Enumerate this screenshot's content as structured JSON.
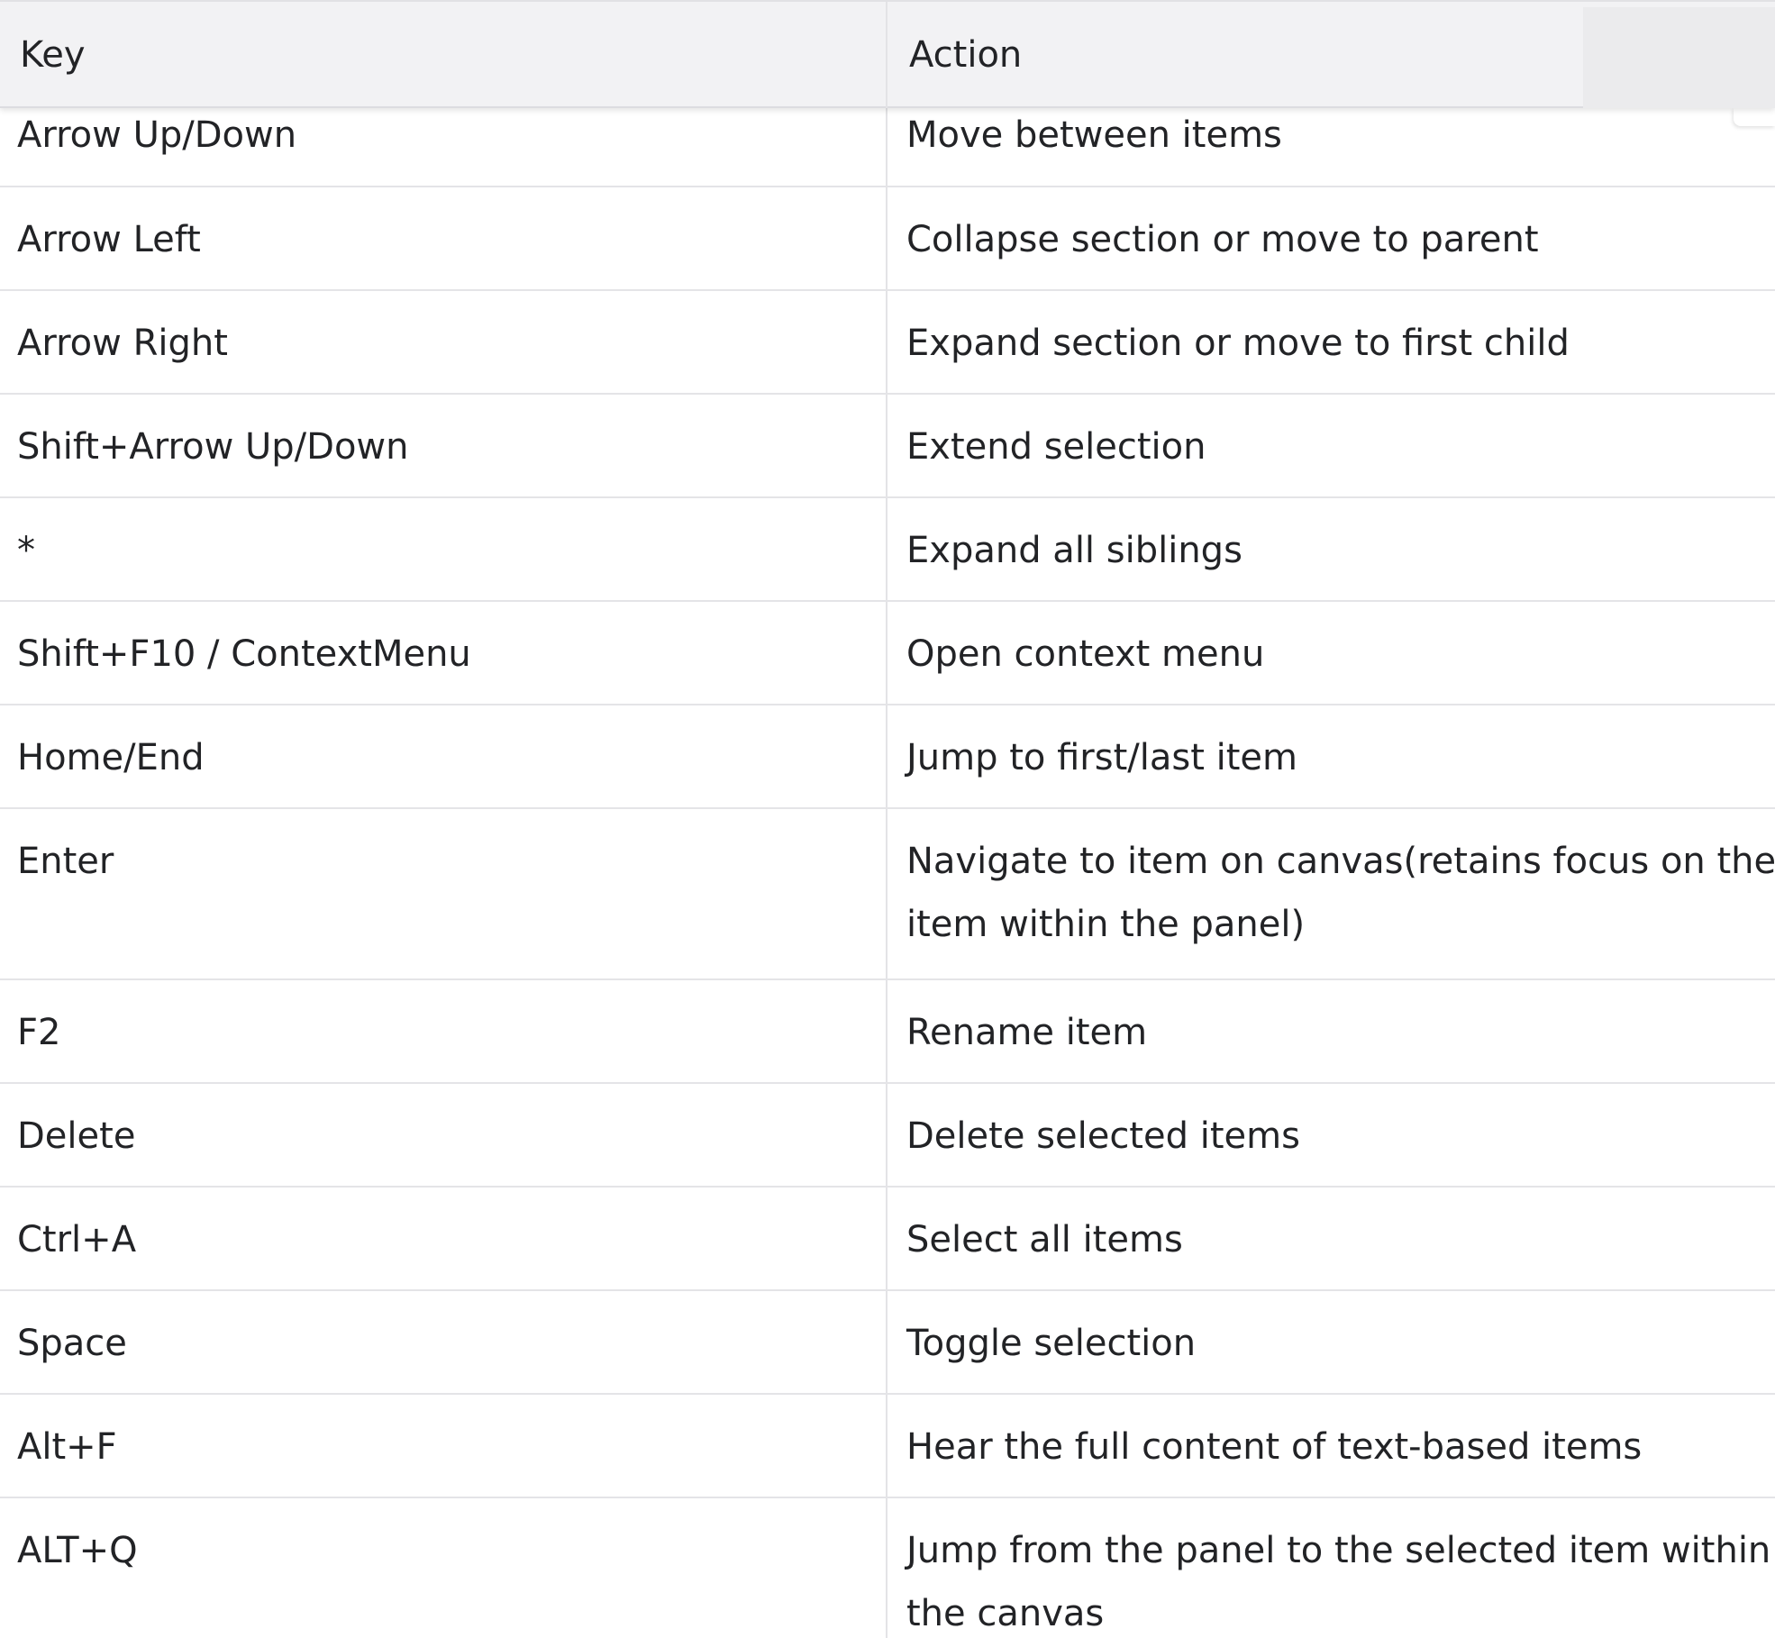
{
  "table": {
    "headers": {
      "key": "Key",
      "action": "Action"
    },
    "rows": [
      {
        "key": "Arrow Up/Down",
        "action": [
          "Move between items"
        ]
      },
      {
        "key": "Arrow Left",
        "action": [
          "Collapse section or move to parent"
        ]
      },
      {
        "key": "Arrow Right",
        "action": [
          "Expand section or move to first child"
        ]
      },
      {
        "key": "Shift+Arrow Up/Down",
        "action": [
          "Extend selection"
        ]
      },
      {
        "key": "*",
        "action": [
          "Expand all siblings"
        ]
      },
      {
        "key": "Shift+F10 / ContextMenu",
        "action": [
          "Open context menu"
        ]
      },
      {
        "key": "Home/End",
        "action": [
          "Jump to first/last item"
        ]
      },
      {
        "key": "Enter",
        "action": [
          "Navigate to item on canvas(retains focus on the",
          "item within the panel)"
        ]
      },
      {
        "key": "F2",
        "action": [
          "Rename item"
        ]
      },
      {
        "key": "Delete",
        "action": [
          "Delete selected items"
        ]
      },
      {
        "key": "Ctrl+A",
        "action": [
          "Select all items"
        ]
      },
      {
        "key": "Space",
        "action": [
          "Toggle selection"
        ]
      },
      {
        "key": "Alt+F",
        "action": [
          "Hear the full content of text-based items"
        ]
      },
      {
        "key": "ALT+Q",
        "action": [
          "Jump from the panel to the selected item within",
          "the canvas"
        ]
      }
    ]
  }
}
